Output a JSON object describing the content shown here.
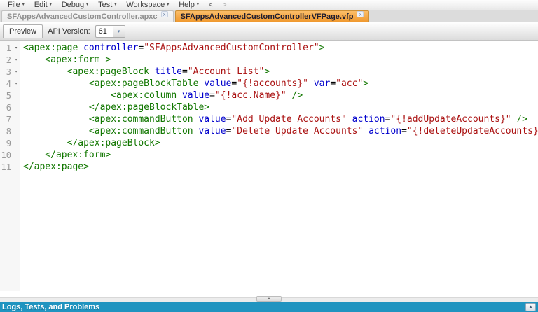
{
  "menu": {
    "items": [
      "File",
      "Edit",
      "Debug",
      "Test",
      "Workspace",
      "Help"
    ],
    "back_arrow": "<",
    "forward_arrow": ">"
  },
  "tabs": [
    {
      "label": "SFAppsAdvancedCustomController.apxc",
      "active": false
    },
    {
      "label": "SFAppsAdvancedCustomControllerVFPage.vfp",
      "active": true
    }
  ],
  "toolbar": {
    "preview_label": "Preview",
    "api_version_label": "API Version:",
    "api_version_value": "61"
  },
  "editor": {
    "lines": [
      {
        "num": "1",
        "fold": true,
        "segments": [
          [
            "<apex:page ",
            "tag"
          ],
          [
            "controller",
            "attr"
          ],
          [
            "=",
            "plain"
          ],
          [
            "\"SFAppsAdvancedCustomController\"",
            "str"
          ],
          [
            ">",
            "tag"
          ]
        ]
      },
      {
        "num": "2",
        "fold": true,
        "segments": [
          [
            "    <apex:form >",
            "tag"
          ]
        ]
      },
      {
        "num": "3",
        "fold": true,
        "segments": [
          [
            "        <apex:pageBlock ",
            "tag"
          ],
          [
            "title",
            "attr"
          ],
          [
            "=",
            "plain"
          ],
          [
            "\"Account List\"",
            "str"
          ],
          [
            ">",
            "tag"
          ]
        ]
      },
      {
        "num": "4",
        "fold": true,
        "segments": [
          [
            "            <apex:pageBlockTable ",
            "tag"
          ],
          [
            "value",
            "attr"
          ],
          [
            "=",
            "plain"
          ],
          [
            "\"{!accounts}\"",
            "str"
          ],
          [
            " ",
            "plain"
          ],
          [
            "var",
            "attr"
          ],
          [
            "=",
            "plain"
          ],
          [
            "\"acc\"",
            "str"
          ],
          [
            ">",
            "tag"
          ]
        ]
      },
      {
        "num": "5",
        "fold": false,
        "segments": [
          [
            "                <apex:column ",
            "tag"
          ],
          [
            "value",
            "attr"
          ],
          [
            "=",
            "plain"
          ],
          [
            "\"{!acc.Name}\"",
            "str"
          ],
          [
            " />",
            "tag"
          ]
        ]
      },
      {
        "num": "6",
        "fold": false,
        "segments": [
          [
            "            </apex:pageBlockTable>",
            "tag"
          ]
        ]
      },
      {
        "num": "7",
        "fold": false,
        "segments": [
          [
            "            <apex:commandButton ",
            "tag"
          ],
          [
            "value",
            "attr"
          ],
          [
            "=",
            "plain"
          ],
          [
            "\"Add Update Accounts\"",
            "str"
          ],
          [
            " ",
            "plain"
          ],
          [
            "action",
            "attr"
          ],
          [
            "=",
            "plain"
          ],
          [
            "\"{!addUpdateAccounts}\"",
            "str"
          ],
          [
            " />",
            "tag"
          ]
        ]
      },
      {
        "num": "8",
        "fold": false,
        "segments": [
          [
            "            <apex:commandButton ",
            "tag"
          ],
          [
            "value",
            "attr"
          ],
          [
            "=",
            "plain"
          ],
          [
            "\"Delete Update Accounts\"",
            "str"
          ],
          [
            " ",
            "plain"
          ],
          [
            "action",
            "attr"
          ],
          [
            "=",
            "plain"
          ],
          [
            "\"{!deleteUpdateAccounts}\"",
            "str"
          ],
          [
            " />",
            "tag"
          ]
        ]
      },
      {
        "num": "9",
        "fold": false,
        "segments": [
          [
            "        </apex:pageBlock>",
            "tag"
          ]
        ]
      },
      {
        "num": "10",
        "fold": false,
        "segments": [
          [
            "    </apex:form>",
            "tag"
          ]
        ]
      },
      {
        "num": "11",
        "fold": false,
        "segments": [
          [
            "</apex:page>",
            "tag"
          ]
        ]
      }
    ]
  },
  "bottom_bar": {
    "label": "Logs, Tests, and Problems"
  },
  "icons": {
    "menu_caret": "▾",
    "tab_close": "x",
    "combo_arrow": "▾",
    "fold_arrow": "▾",
    "splitter_up": "▲",
    "expand_up": "▲"
  },
  "colors": {
    "tag": "#117700",
    "attribute": "#0000cc",
    "string": "#aa1111",
    "active_tab_top": "#fbbd68",
    "active_tab_bottom": "#f0992f",
    "panel_header_bg": "#2094c0"
  }
}
